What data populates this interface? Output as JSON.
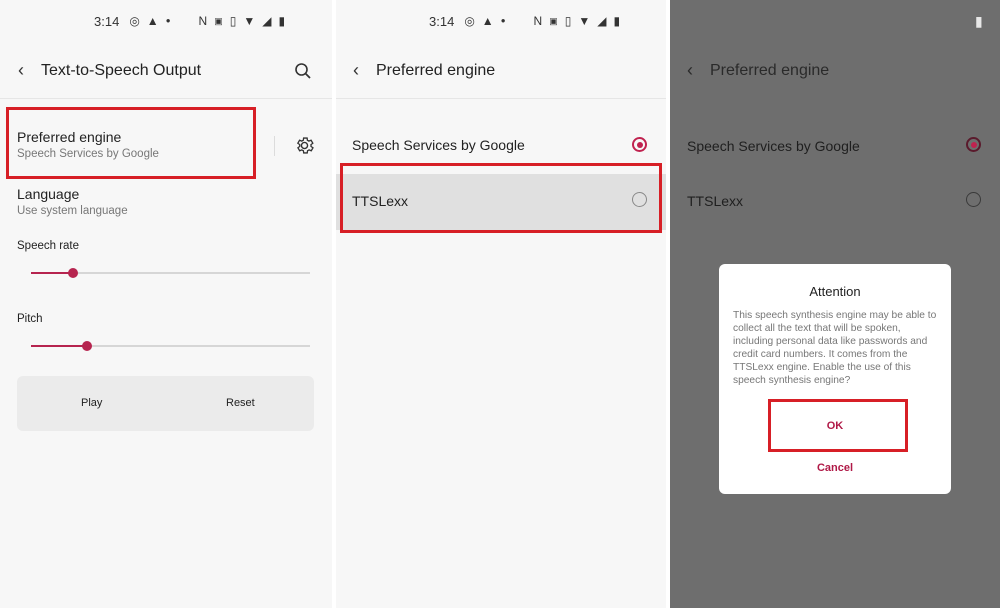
{
  "status_bar": {
    "time": "3:14"
  },
  "screen1": {
    "title": "Text-to-Speech Output",
    "preferred_engine": {
      "title": "Preferred engine",
      "subtitle": "Speech Services by Google"
    },
    "language": {
      "title": "Language",
      "subtitle": "Use system language"
    },
    "speech_rate": {
      "label": "Speech rate",
      "value": 0.15
    },
    "pitch": {
      "label": "Pitch",
      "value": 0.2
    },
    "play_label": "Play",
    "reset_label": "Reset"
  },
  "screen2": {
    "title": "Preferred engine",
    "engines": [
      {
        "label": "Speech Services by Google",
        "selected": true
      },
      {
        "label": "TTSLexx",
        "selected": false
      }
    ]
  },
  "screen3": {
    "title": "Preferred engine",
    "engines": [
      {
        "label": "Speech Services by Google",
        "selected": true
      },
      {
        "label": "TTSLexx",
        "selected": false
      }
    ],
    "dialog": {
      "title": "Attention",
      "body": "This speech synthesis engine may be able to collect all the text that will be spoken, including personal data like passwords and credit card numbers. It comes from the TTSLexx engine. Enable the use of this speech synthesis engine?",
      "ok_label": "OK",
      "cancel_label": "Cancel"
    }
  },
  "colors": {
    "accent": "#b6244f",
    "highlight": "#d71f26",
    "scrim": "#6e6e6e"
  }
}
